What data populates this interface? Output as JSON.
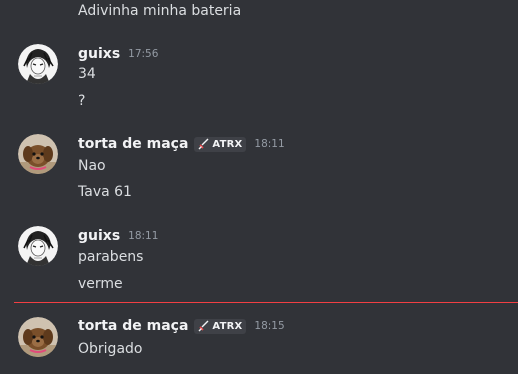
{
  "top_message": "Adivinha minha bateria",
  "groups": [
    {
      "username": "guixs",
      "timestamp": "17:56",
      "avatar_icon": "manga-avatar-icon",
      "lines": [
        "34",
        "?"
      ]
    },
    {
      "username": "torta de maça",
      "timestamp": "18:11",
      "avatar_icon": "dog-avatar-icon",
      "tag": {
        "icon": "sword-icon",
        "label": "ATRX"
      },
      "lines": [
        "Nao",
        "Tava 61"
      ]
    },
    {
      "username": "guixs",
      "timestamp": "18:11",
      "avatar_icon": "manga-avatar-icon",
      "lines": [
        "parabens",
        "verme"
      ]
    },
    {
      "username": "torta de maça",
      "timestamp": "18:15",
      "avatar_icon": "dog-avatar-icon",
      "tag": {
        "icon": "sword-icon",
        "label": "ATRX"
      },
      "lines": [
        "Obrigado"
      ]
    }
  ],
  "colors": {
    "background": "#313338",
    "new_messages_divider": "#f23f43",
    "tag_background": "#3f4147"
  }
}
